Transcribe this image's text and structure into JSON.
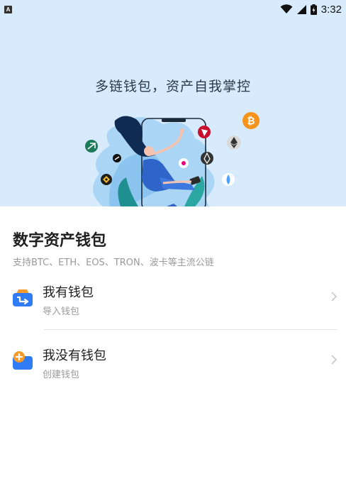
{
  "status_bar": {
    "left_badge": "A",
    "time": "3:32",
    "icons": [
      "wifi-icon",
      "cell-signal-icon",
      "battery-charging-icon"
    ]
  },
  "hero": {
    "slogan": "多链钱包，资产自我掌控",
    "background_color": "#d7ebfc",
    "coin_icons": [
      "bitcoin-icon",
      "ethereum-icon",
      "tron-icon",
      "eos-icon",
      "polkadot-icon",
      "binance-icon",
      "sui-icon",
      "staking-icon"
    ]
  },
  "main": {
    "title": "数字资产钱包",
    "subtitle": "支持BTC、ETH、EOS、TRON、波卡等主流公链",
    "options": [
      {
        "title": "我有钱包",
        "subtitle": "导入钱包",
        "icon": "import-wallet-icon"
      },
      {
        "title": "我没有钱包",
        "subtitle": "创建钱包",
        "icon": "create-wallet-icon"
      }
    ]
  },
  "colors": {
    "accent_blue": "#2f7cf6",
    "accent_orange": "#f7931a"
  }
}
